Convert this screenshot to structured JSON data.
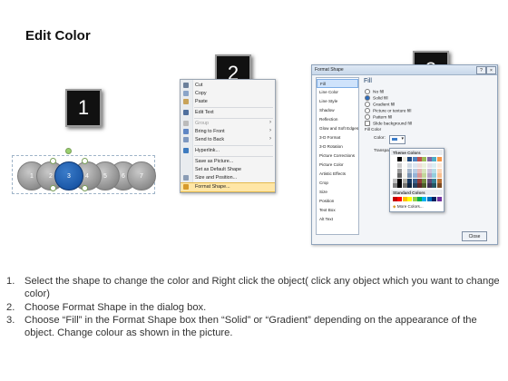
{
  "title": "Edit Color",
  "badges": [
    "1",
    "2",
    "3"
  ],
  "circles": [
    "1",
    "2",
    "3",
    "4",
    "5",
    "6",
    "7"
  ],
  "context_menu": {
    "items": [
      {
        "label": "Cut",
        "icon": "scissors-icon"
      },
      {
        "label": "Copy",
        "icon": "copy-icon"
      },
      {
        "label": "Paste",
        "icon": "paste-icon"
      },
      {
        "label": "Edit Text",
        "icon": "edit-text-icon"
      },
      {
        "label": "Group",
        "icon": "group-icon",
        "disabled": true
      },
      {
        "label": "Bring to Front",
        "icon": "bring-to-front-icon"
      },
      {
        "label": "Send to Back",
        "icon": "send-to-back-icon"
      },
      {
        "label": "Hyperlink...",
        "icon": "hyperlink-icon"
      },
      {
        "label": "Save as Picture...",
        "icon": "none"
      },
      {
        "label": "Set as Default Shape",
        "icon": "none"
      },
      {
        "label": "Size and Position...",
        "icon": "size-position-icon"
      },
      {
        "label": "Format Shape...",
        "icon": "format-shape-icon",
        "highlighted": true
      }
    ]
  },
  "dialog": {
    "title": "Format Shape",
    "categories": [
      "Fill",
      "Line Color",
      "Line Style",
      "Shadow",
      "Reflection",
      "Glow and Soft Edges",
      "3-D Format",
      "3-D Rotation",
      "Picture Corrections",
      "Picture Color",
      "Artistic Effects",
      "Crop",
      "Size",
      "Position",
      "Text Box",
      "Alt Text"
    ],
    "panel_title": "Fill",
    "options": [
      "No fill",
      "Solid fill",
      "Gradient fill",
      "Picture or texture fill",
      "Pattern fill",
      "Slide background fill"
    ],
    "fill_color_label": "Fill Color",
    "color_label": "Color:",
    "transparency_label": "Transpa",
    "palette": {
      "theme_label": "Theme Colors",
      "standard_label": "Standard Colors",
      "more_label": "More Colors..."
    },
    "close_label": "Close"
  },
  "instructions": [
    {
      "num": "1.",
      "text": "Select the shape to change the color and Right click the object( click any object which you want to change color)"
    },
    {
      "num": "2.",
      "text": "Choose Format Shape in the dialog box."
    },
    {
      "num": "3.",
      "text": "Choose “Fill” in the Format Shape box then “Solid” or “Gradient” depending on the appearance of the object. Change colour as shown in the picture."
    }
  ],
  "colors": {
    "badge_bg": "#111111",
    "selected_circle": "#1b58a8",
    "circle_gray": "#8d8d8d",
    "menu_highlight": "#ffe6a6"
  }
}
